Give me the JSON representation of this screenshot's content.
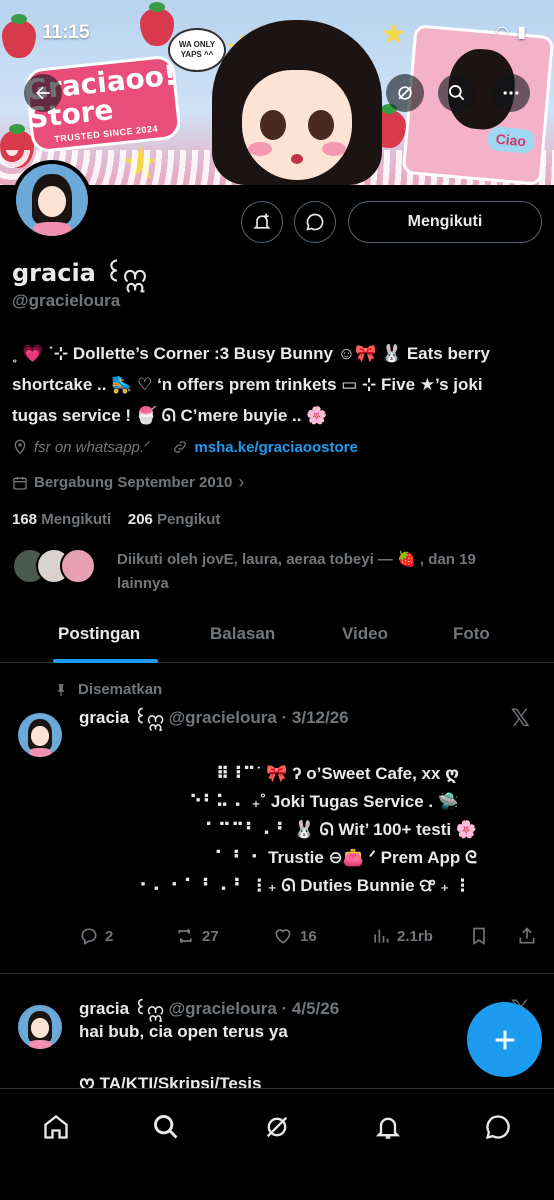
{
  "status_bar": {
    "time": "11:15"
  },
  "banner": {
    "store_name": "Graciaoo! Store",
    "tagline": "TRUSTED SINCE 2024",
    "bubble": "WA ONLY YAPS ^^",
    "card_label": "Ciao"
  },
  "header_actions": {
    "follow_label": "Mengikuti"
  },
  "profile": {
    "name": "gracia ꒰ဣ",
    "handle": "@gracieloura",
    "bio_lines": [
      "˳ 💗 ˙⊹ Dollette’s Corner :3 Busy Bunny ☺︎🎀 🐰 Eats berry",
      "shortcake .. 🛼 ♡ ‘n offers prem trinkets ▭ ⊹ Five ★’s joki",
      "tugas service ! 🍧 ᘏ C’mere buyie .. 🌸"
    ],
    "location": "fsr on whatsapp.ᐟ",
    "link": "msha.ke/graciaoostore",
    "joined": "Bergabung September 2010",
    "following_count": "168",
    "following_label": "Mengikuti",
    "followers_count": "206",
    "followers_label": "Pengikut",
    "followed_by": "Diikuti oleh jovE, laura, aeraa tobeyi — 🍓 , dan 19 lainnya"
  },
  "tabs": [
    "Postingan",
    "Balasan",
    "Video",
    "Foto"
  ],
  "pinned_label": "Disematkan",
  "posts": [
    {
      "name": "gracia ꒰ဣ",
      "handle": "@gracieloura",
      "date": "3/12/26",
      "lines": [
        "⠿⠸⠉˙ 🎀 ʔ o’Sweet Cafe, xx ღ",
        "⠑⠃⠥ ⠄ ₊˚ Joki Tugas Service . 🛸",
        "⠁⠉⠉⠃ ⠄⠃ 🐰 ᘏ Wit’ 100+ testi 🌸",
        "⠁ ⠃ ⠂ Trustie ⊖👛 ᐟ Prem App ᘓ",
        "⠂⠄ ⠂⠁ ⠃ ⠄⠃ ⋮₊ ᘏ Duties Bunnie ଫ ₊ ⋮"
      ],
      "replies": "2",
      "reposts": "27",
      "likes": "16",
      "views": "2.1rb"
    },
    {
      "name": "gracia ꒰ဣ",
      "handle": "@gracieloura",
      "date": "4/5/26",
      "text": "hai bub, cia open terus ya",
      "text2": "ᰔ TA/KTI/Skripsi/Tesis"
    }
  ],
  "colors": {
    "accent": "#1d9bf0",
    "background": "#000000",
    "muted": "#71767b",
    "text": "#e7e9ea"
  },
  "icons": [
    "back-arrow-icon",
    "grok-icon",
    "search-icon",
    "more-icon",
    "notify-plus-icon",
    "message-icon",
    "location-icon",
    "link-icon",
    "calendar-icon",
    "pin-icon",
    "x-logo-icon",
    "reply-icon",
    "repost-icon",
    "like-icon",
    "views-icon",
    "bookmark-icon",
    "share-icon",
    "compose-icon",
    "home-icon",
    "communities-icon",
    "bell-icon",
    "mail-icon"
  ]
}
